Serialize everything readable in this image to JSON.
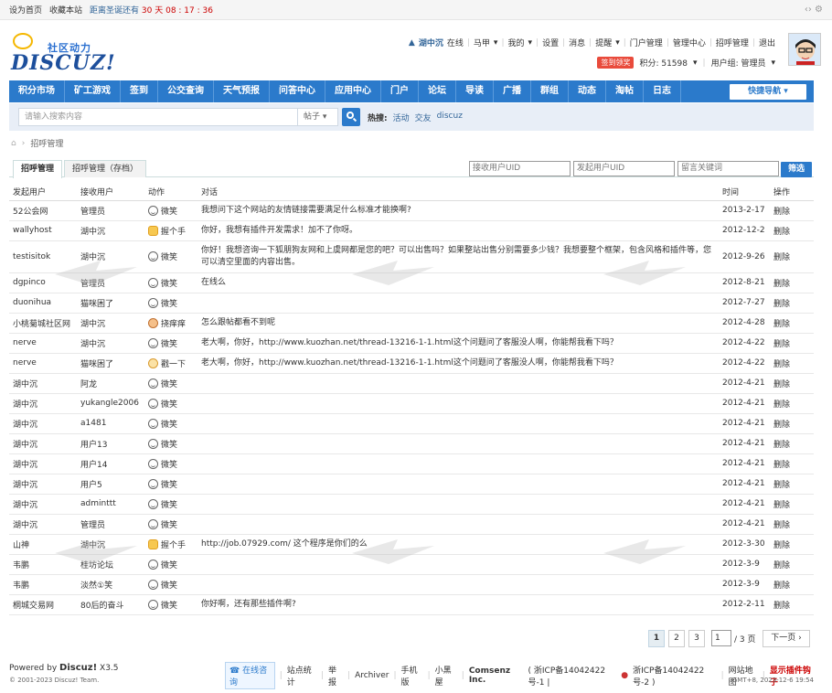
{
  "topbar": {
    "set_home": "设为首页",
    "bookmark": "收藏本站",
    "countdown_label": "距离圣诞还有",
    "countdown_value": "30 天 08 : 17 : 36"
  },
  "logo": {
    "cn": "社区动力",
    "en": "DISCUZ!"
  },
  "userbar": {
    "username": "湖中沉",
    "status": "在线",
    "items": [
      "马甲",
      "我的",
      "设置",
      "消息",
      "提醒",
      "门户管理",
      "管理中心",
      "招呼管理",
      "退出"
    ]
  },
  "userinfo": {
    "sign": "签到领奖",
    "points": "积分: 51598",
    "group": "用户组: 管理员"
  },
  "nav": {
    "items": [
      "积分市场",
      "矿工游戏",
      "签到",
      "公交查询",
      "天气预报",
      "问答中心",
      "应用中心",
      "门户",
      "论坛",
      "导读",
      "广播",
      "群组",
      "动态",
      "淘帖",
      "日志"
    ],
    "quick": "快捷导航"
  },
  "search": {
    "placeholder": "请输入搜索内容",
    "type": "帖子",
    "hot_label": "热搜:",
    "hot": [
      "活动",
      "交友",
      "discuz"
    ]
  },
  "crumb": {
    "current": "招呼管理"
  },
  "tabs": [
    "招呼管理",
    "招呼管理（存档）"
  ],
  "filters": {
    "recv": "接收用户UID",
    "send": "发起用户UID",
    "keyword": "留言关键词",
    "submit": "筛选"
  },
  "table": {
    "headers": [
      "发起用户",
      "接收用户",
      "动作",
      "对话",
      "时间",
      "操作"
    ],
    "rows": [
      {
        "from": "52公会网",
        "to": "管理员",
        "act": "微笑",
        "icon": "smile",
        "msg": "我想问下这个网站的友情链接需要满足什么标准才能换啊?",
        "time": "2013-2-17",
        "op": "删除"
      },
      {
        "from": "wallyhost",
        "to": "湖中沉",
        "act": "握个手",
        "icon": "hand",
        "msg": "你好，我想有插件开发需求！加不了你呀。",
        "time": "2012-12-2",
        "op": "删除"
      },
      {
        "from": "testisitok",
        "to": "湖中沉",
        "act": "微笑",
        "icon": "smile",
        "msg": "你好！我想咨询一下狐朋狗友网和上虞网都是您的吧？可以出售吗？如果整站出售分别需要多少钱？我想要整个框架，包含风格和插件等，您可以清空里面的内容出售。",
        "time": "2012-9-26",
        "op": "删除",
        "tall": true
      },
      {
        "from": "dgpinco",
        "to": "管理员",
        "act": "微笑",
        "icon": "smile",
        "msg": "在线么",
        "time": "2012-8-21",
        "op": "删除"
      },
      {
        "from": "duonihua",
        "to": "猫咪困了",
        "act": "微笑",
        "icon": "smile",
        "msg": "",
        "time": "2012-7-27",
        "op": "删除"
      },
      {
        "from": "小桃菊城社区网",
        "to": "湖中沉",
        "act": "挠痒痒",
        "icon": "tickle",
        "msg": "怎么跟帖都看不到呢",
        "time": "2012-4-28",
        "op": "删除"
      },
      {
        "from": "nerve",
        "to": "湖中沉",
        "act": "微笑",
        "icon": "smile",
        "msg": "老大啊，你好，http://www.kuozhan.net/thread-13216-1-1.html这个问题问了客服没人啊，你能帮我看下吗？",
        "time": "2012-4-22",
        "op": "删除"
      },
      {
        "from": "nerve",
        "to": "猫咪困了",
        "act": "戳一下",
        "icon": "poke",
        "msg": "老大啊，你好，http://www.kuozhan.net/thread-13216-1-1.html这个问题问了客服没人啊，你能帮我看下吗？",
        "time": "2012-4-22",
        "op": "删除"
      },
      {
        "from": "湖中沉",
        "to": "阿龙",
        "act": "微笑",
        "icon": "smile",
        "msg": "",
        "time": "2012-4-21",
        "op": "删除"
      },
      {
        "from": "湖中沉",
        "to": "yukangle2006",
        "act": "微笑",
        "icon": "smile",
        "msg": "",
        "time": "2012-4-21",
        "op": "删除"
      },
      {
        "from": "湖中沉",
        "to": "a1481",
        "act": "微笑",
        "icon": "smile",
        "msg": "",
        "time": "2012-4-21",
        "op": "删除"
      },
      {
        "from": "湖中沉",
        "to": "用户13",
        "act": "微笑",
        "icon": "smile",
        "msg": "",
        "time": "2012-4-21",
        "op": "删除"
      },
      {
        "from": "湖中沉",
        "to": "用户14",
        "act": "微笑",
        "icon": "smile",
        "msg": "",
        "time": "2012-4-21",
        "op": "删除"
      },
      {
        "from": "湖中沉",
        "to": "用户5",
        "act": "微笑",
        "icon": "smile",
        "msg": "",
        "time": "2012-4-21",
        "op": "删除"
      },
      {
        "from": "湖中沉",
        "to": "adminttt",
        "act": "微笑",
        "icon": "smile",
        "msg": "",
        "time": "2012-4-21",
        "op": "删除"
      },
      {
        "from": "湖中沉",
        "to": "管理员",
        "act": "微笑",
        "icon": "smile",
        "msg": "",
        "time": "2012-4-21",
        "op": "删除"
      },
      {
        "from": "山神",
        "to": "湖中沉",
        "act": "握个手",
        "icon": "hand",
        "msg": "http://job.07929.com/ 这个程序是你们的么",
        "time": "2012-3-30",
        "op": "删除"
      },
      {
        "from": "韦鹏",
        "to": "桂坊论坛",
        "act": "微笑",
        "icon": "smile",
        "msg": "",
        "time": "2012-3-9",
        "op": "删除"
      },
      {
        "from": "韦鹏",
        "to": "淡然①笑",
        "act": "微笑",
        "icon": "smile",
        "msg": "",
        "time": "2012-3-9",
        "op": "删除"
      },
      {
        "from": "桐城交易网",
        "to": "80后的奋斗",
        "act": "微笑",
        "icon": "smile",
        "msg": "你好啊，还有那些插件啊?",
        "time": "2012-2-11",
        "op": "删除"
      }
    ]
  },
  "pager": {
    "pages": [
      "1",
      "2",
      "3"
    ],
    "input": "1",
    "total": "/ 3 页",
    "next": "下一页"
  },
  "footer": {
    "powered": "Powered by",
    "product": "Discuz!",
    "version": "X3.5",
    "copyright": "© 2001-2023 Discuz! Team.",
    "consult": "在线咨询",
    "links": [
      "站点统计",
      "举报",
      "Archiver",
      "手机版",
      "小黑屋"
    ],
    "company": "Comsenz Inc.",
    "icp1": "( 浙ICP备14042422号-1 |",
    "icp2": "浙ICP备14042422号-2 )",
    "sitemap": "网站地图",
    "plugin": "显示插件钩子",
    "gmt": "GMT+8, 2023-12-6 19:54"
  }
}
